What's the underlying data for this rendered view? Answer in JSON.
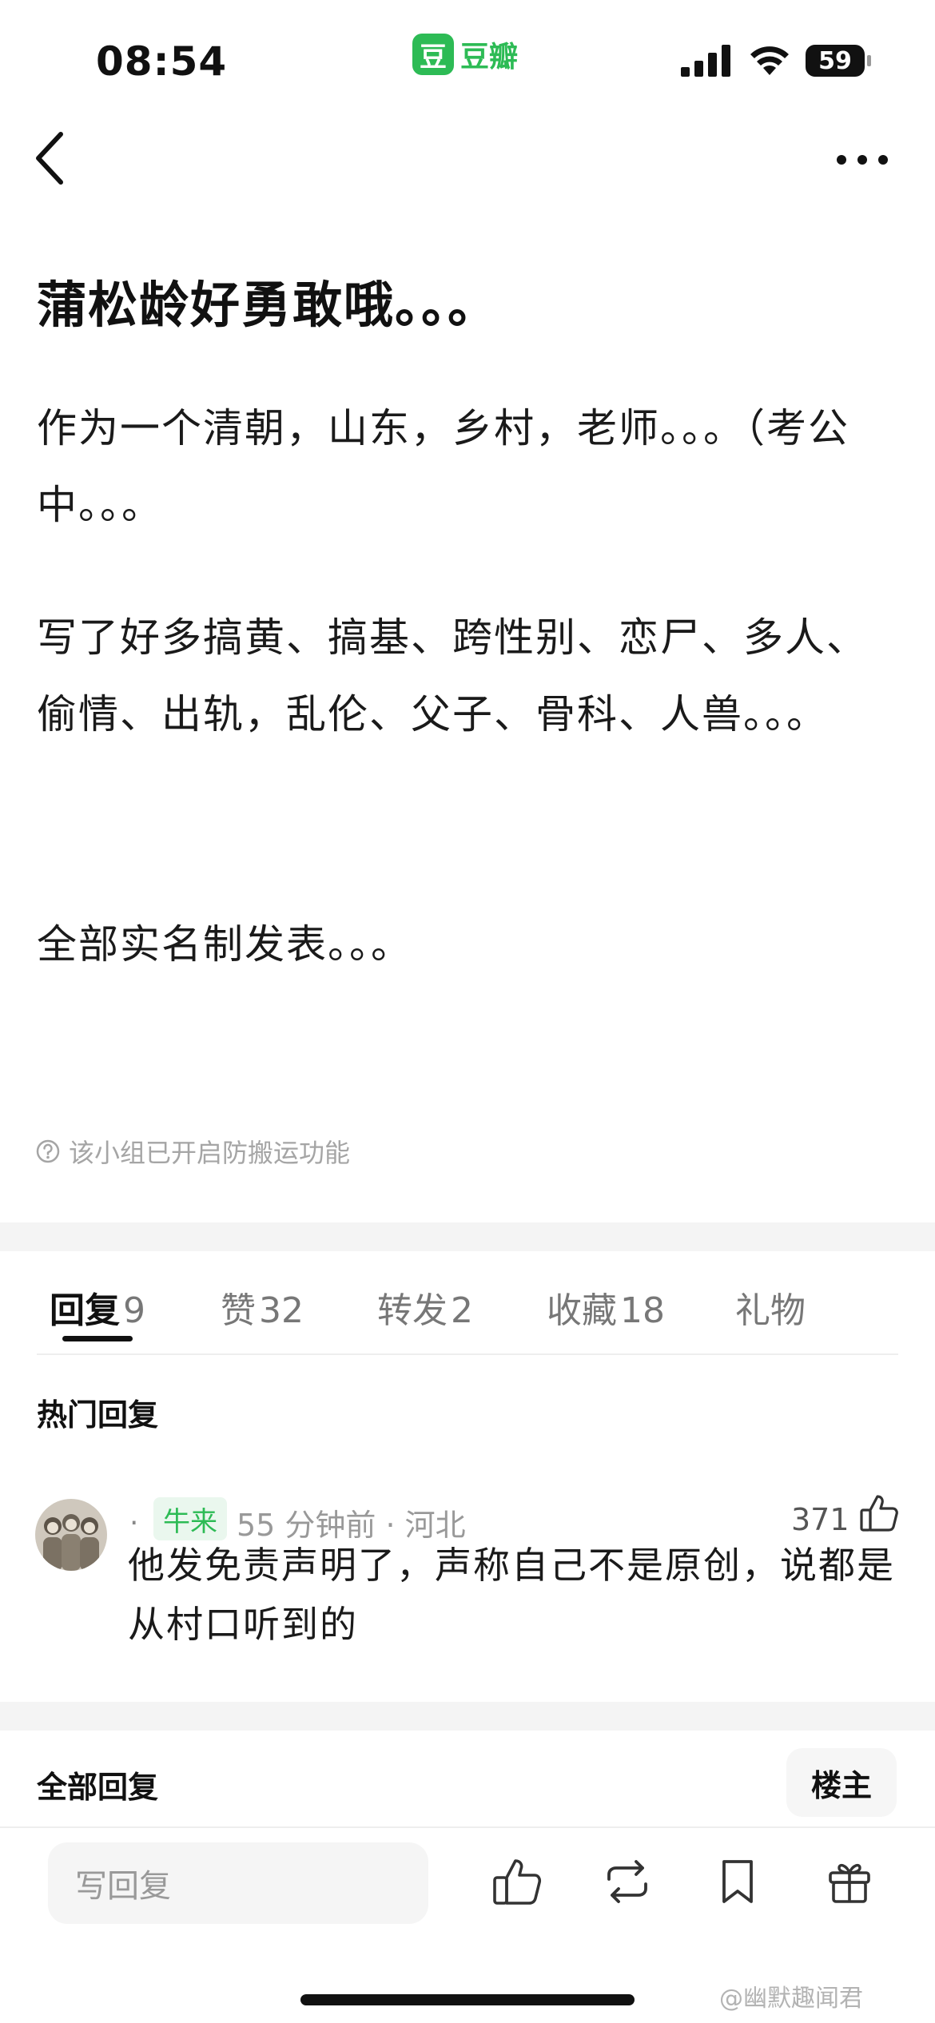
{
  "status_bar": {
    "time": "08:54",
    "app_logo_char": "豆",
    "app_name": "豆瓣",
    "battery": "59"
  },
  "nav": {
    "back_icon": "chevron-left-icon",
    "more_icon": "ellipsis-icon"
  },
  "post": {
    "title": "蒲松龄好勇敢哦。。。",
    "paragraphs": [
      "作为一个清朝，山东，乡村，老师。。。（考公中。。。",
      "写了好多搞黄、搞基、跨性别、恋尸、多人、偷情、出轨，乱伦、父子、骨科、人兽。。。",
      "全部实名制发表。。。"
    ],
    "notice": "该小组已开启防搬运功能"
  },
  "tabs": [
    {
      "label": "回复",
      "count": "9",
      "active": true
    },
    {
      "label": "赞",
      "count": "32",
      "active": false
    },
    {
      "label": "转发",
      "count": "2",
      "active": false
    },
    {
      "label": "收藏",
      "count": "18",
      "active": false
    },
    {
      "label": "礼物",
      "count": "",
      "active": false
    }
  ],
  "hot_replies": {
    "title": "热门回复",
    "items": [
      {
        "tag": "牛来",
        "meta": "55 分钟前 · 河北",
        "likes": "371",
        "text": "他发免责声明了，声称自己不是原创，说都是从村口听到的"
      }
    ]
  },
  "all_replies": {
    "title": "全部回复",
    "op_filter": "楼主"
  },
  "bottom_bar": {
    "reply_placeholder": "写回复",
    "icons": [
      "thumbs-up-icon",
      "repost-icon",
      "bookmark-icon",
      "gift-icon"
    ]
  },
  "watermark": "@幽默趣闻君",
  "colors": {
    "brand_green": "#2dbb55",
    "text_primary": "#111111",
    "text_secondary": "#999999"
  }
}
